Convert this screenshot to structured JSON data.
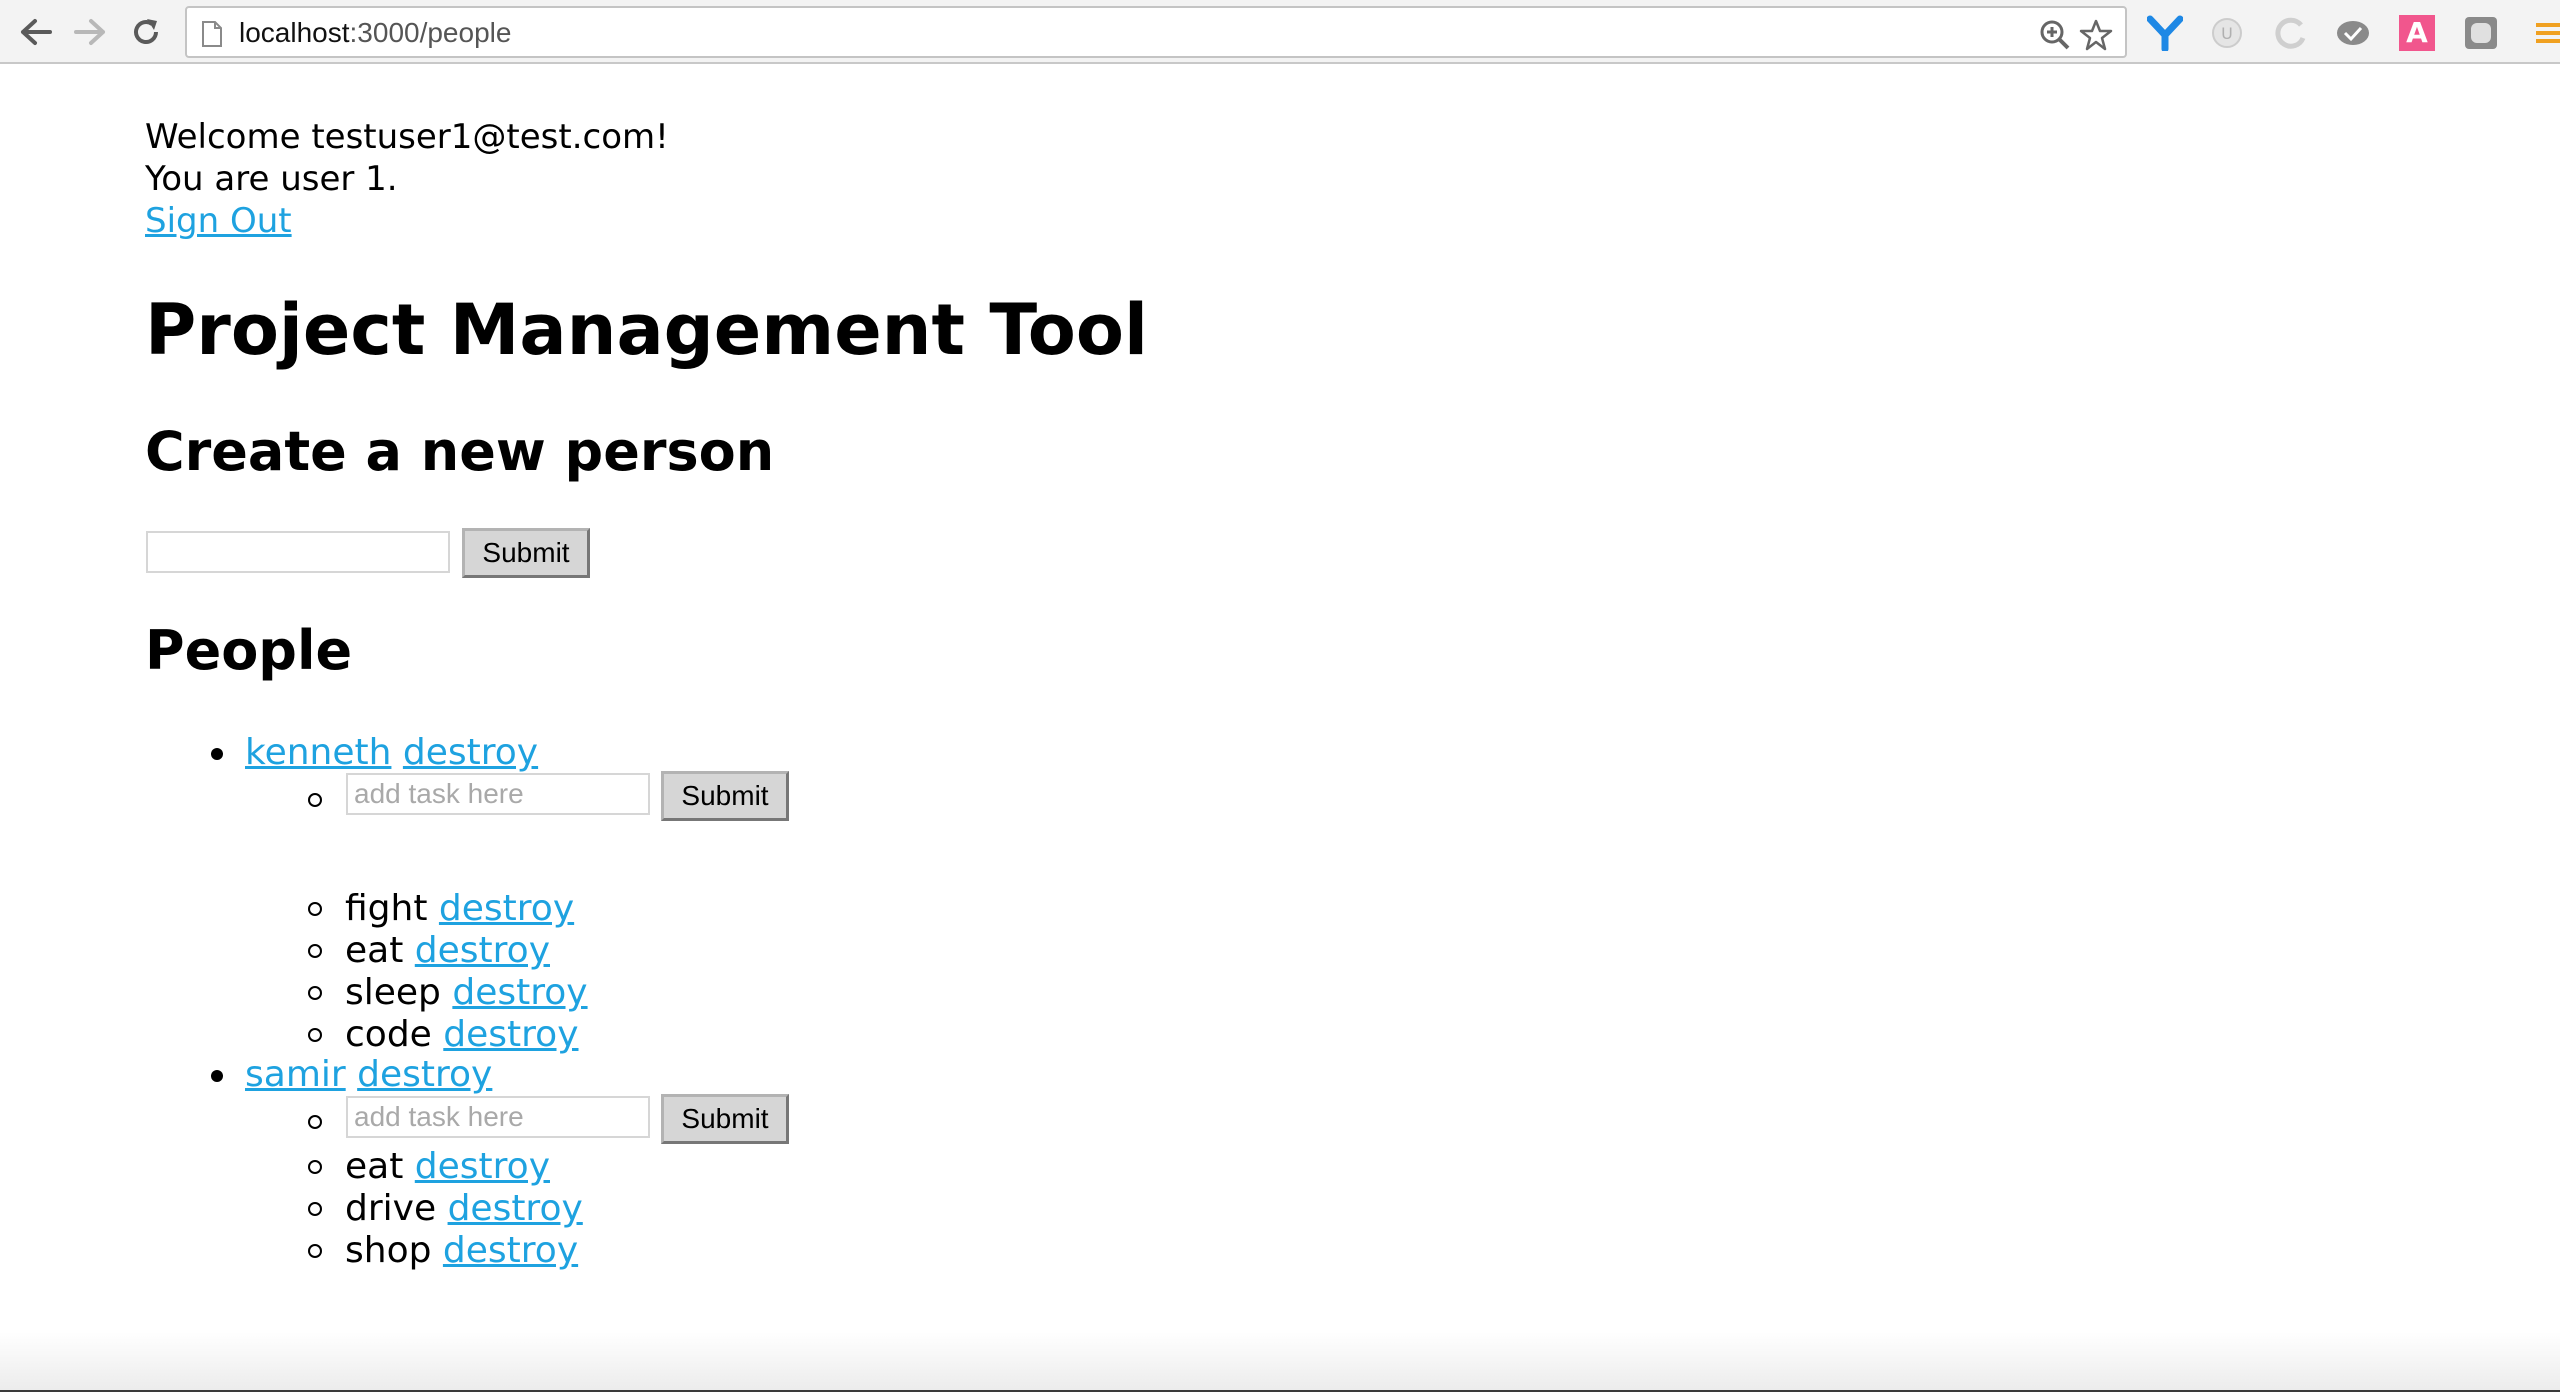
{
  "browser": {
    "url_host": "localhost",
    "url_rest": ":3000/people",
    "extension_a_label": "A",
    "extension_u_label": "U"
  },
  "header": {
    "welcome": "Welcome testuser1@test.com!",
    "user_line": "You are user 1.",
    "sign_out": "Sign Out"
  },
  "page_title": "Project Management Tool",
  "create_section": {
    "heading": "Create a new person",
    "input_value": "",
    "submit_label": "Submit"
  },
  "people_section": {
    "heading": "People",
    "people": [
      {
        "name": "kenneth",
        "destroy_label": "destroy",
        "task_placeholder": "add task here",
        "submit_label": "Submit",
        "tasks": [
          {
            "name": "fight",
            "destroy_label": "destroy"
          },
          {
            "name": "eat",
            "destroy_label": "destroy"
          },
          {
            "name": "sleep",
            "destroy_label": "destroy"
          },
          {
            "name": "code",
            "destroy_label": "destroy"
          }
        ]
      },
      {
        "name": "samir",
        "destroy_label": "destroy",
        "task_placeholder": "add task here",
        "submit_label": "Submit",
        "tasks": [
          {
            "name": "eat",
            "destroy_label": "destroy"
          },
          {
            "name": "drive",
            "destroy_label": "destroy"
          },
          {
            "name": "shop",
            "destroy_label": "destroy"
          }
        ]
      }
    ]
  },
  "colors": {
    "link": "#1ea2e0",
    "toolbar": "#f3f3f3"
  }
}
